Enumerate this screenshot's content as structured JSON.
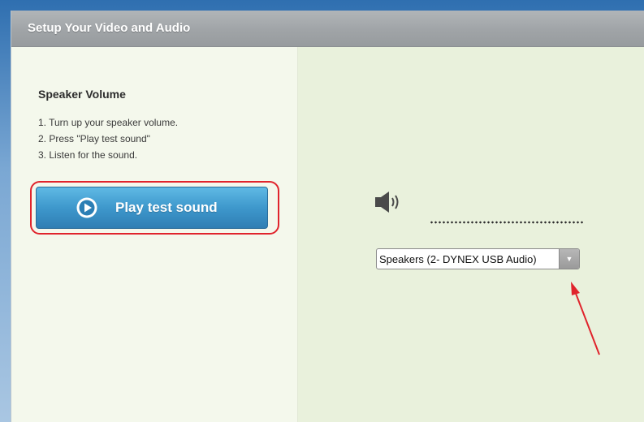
{
  "dialog": {
    "title": "Setup Your Video and Audio"
  },
  "speaker": {
    "section_title": "Speaker Volume",
    "steps": [
      "1. Turn up your speaker volume.",
      "2. Press \"Play test sound\"",
      "3. Listen for the sound."
    ],
    "play_button_label": "Play test sound",
    "device_select_value": "Speakers (2- DYNEX USB Audio)",
    "dropdown_arrow": "▼"
  },
  "icons": {
    "play": "play-circle-icon",
    "speaker": "speaker-volume-icon",
    "dropdown": "chevron-down-icon",
    "annotation": "red-arrow-annotation"
  },
  "colors": {
    "highlight": "#e0242c",
    "button_top": "#5fb9e4",
    "button_bottom": "#2f7fb4",
    "annotation_arrow": "#e0242c"
  }
}
